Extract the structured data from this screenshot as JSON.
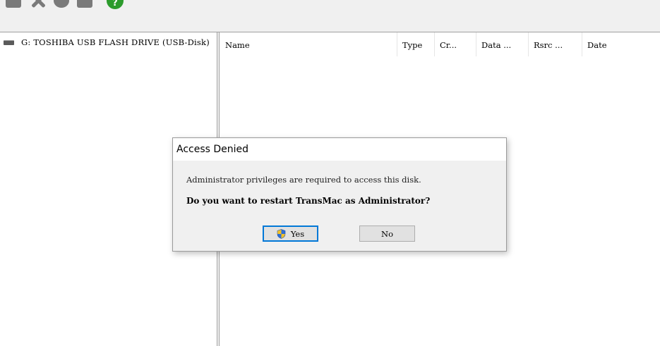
{
  "toolbar": {
    "icons": [
      "copy-icon",
      "delete-icon",
      "info-icon",
      "folder-icon",
      "help-icon"
    ],
    "help_color": "#2c9b2c"
  },
  "tree": {
    "drive_label": "G: TOSHIBA USB FLASH DRIVE (USB-Disk)"
  },
  "list": {
    "columns": [
      "Name",
      "Type",
      "Cr...",
      "Data ...",
      "Rsrc ...",
      "Date"
    ]
  },
  "dialog": {
    "title": "Access Denied",
    "message": "Administrator privileges are required to access this disk.",
    "question": "Do you want to restart TransMac as Administrator?",
    "yes_label": "Yes",
    "no_label": "No",
    "accent": "#0078d7"
  }
}
